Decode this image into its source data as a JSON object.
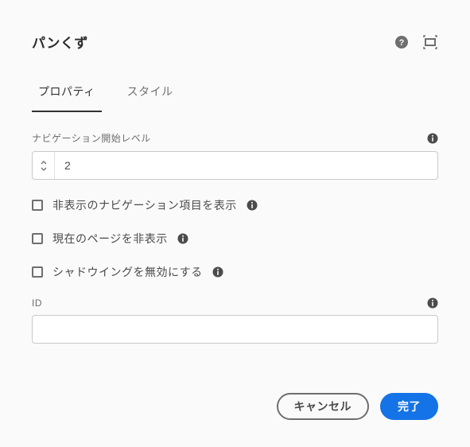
{
  "header": {
    "title": "パンくず"
  },
  "tabs": {
    "items": [
      {
        "label": "プロパティ",
        "active": true
      },
      {
        "label": "スタイル",
        "active": false
      }
    ]
  },
  "fields": {
    "navStartLevel": {
      "label": "ナビゲーション開始レベル",
      "value": "2"
    },
    "showHidden": {
      "label": "非表示のナビゲーション項目を表示",
      "checked": false
    },
    "hideCurrent": {
      "label": "現在のページを非表示",
      "checked": false
    },
    "disableShadowing": {
      "label": "シャドウイングを無効にする",
      "checked": false
    },
    "id": {
      "label": "ID",
      "value": ""
    }
  },
  "footer": {
    "cancel": "キャンセル",
    "done": "完了"
  }
}
